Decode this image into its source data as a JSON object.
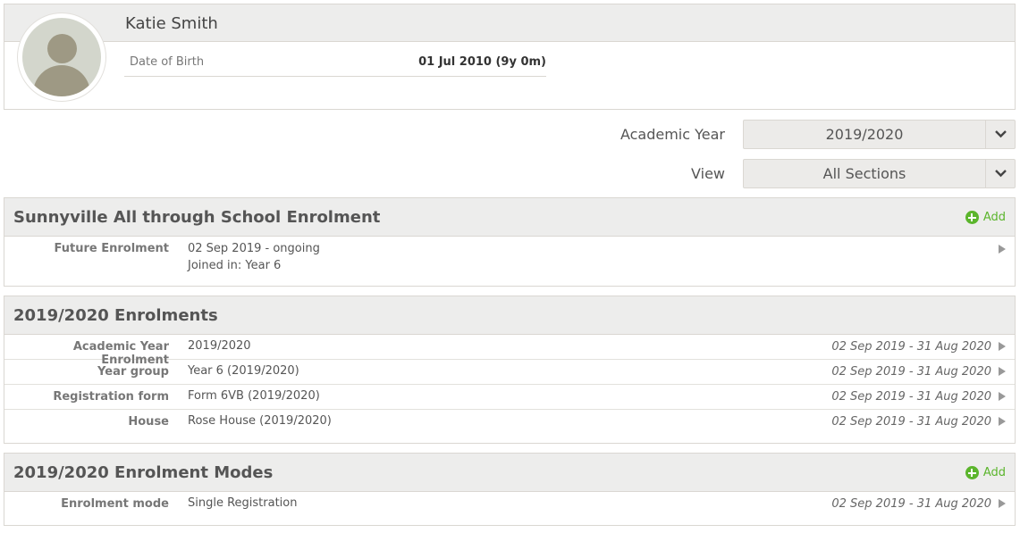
{
  "profile": {
    "name": "Katie Smith",
    "dob_label": "Date of Birth",
    "dob_value": "01 Jul 2010 (9y 0m)"
  },
  "filters": {
    "academic_year_label": "Academic Year",
    "academic_year_value": "2019/2020",
    "view_label": "View",
    "view_value": "All Sections"
  },
  "school_enrolment": {
    "title": "Sunnyville All through School Enrolment",
    "add_label": "Add",
    "rows": [
      {
        "label": "Future Enrolment",
        "value_line1": "02 Sep 2019 - ongoing",
        "value_line2": "Joined in: Year 6"
      }
    ]
  },
  "year_enrolments": {
    "title": "2019/2020 Enrolments",
    "rows": [
      {
        "label": "Academic Year Enrolment",
        "value": "2019/2020",
        "date": "02 Sep 2019 - 31 Aug 2020"
      },
      {
        "label": "Year group",
        "value": "Year 6 (2019/2020)",
        "date": "02 Sep 2019 - 31 Aug 2020"
      },
      {
        "label": "Registration form",
        "value": "Form 6VB (2019/2020)",
        "date": "02 Sep 2019 - 31 Aug 2020"
      },
      {
        "label": "House",
        "value": "Rose House (2019/2020)",
        "date": "02 Sep 2019 - 31 Aug 2020"
      }
    ]
  },
  "enrolment_modes": {
    "title": "2019/2020 Enrolment Modes",
    "add_label": "Add",
    "rows": [
      {
        "label": "Enrolment mode",
        "value": "Single Registration",
        "date": "02 Sep 2019 - 31 Aug 2020"
      }
    ]
  },
  "colors": {
    "accent_green": "#5bb52c",
    "header_band": "#ededec",
    "border": "#dad7d2"
  }
}
